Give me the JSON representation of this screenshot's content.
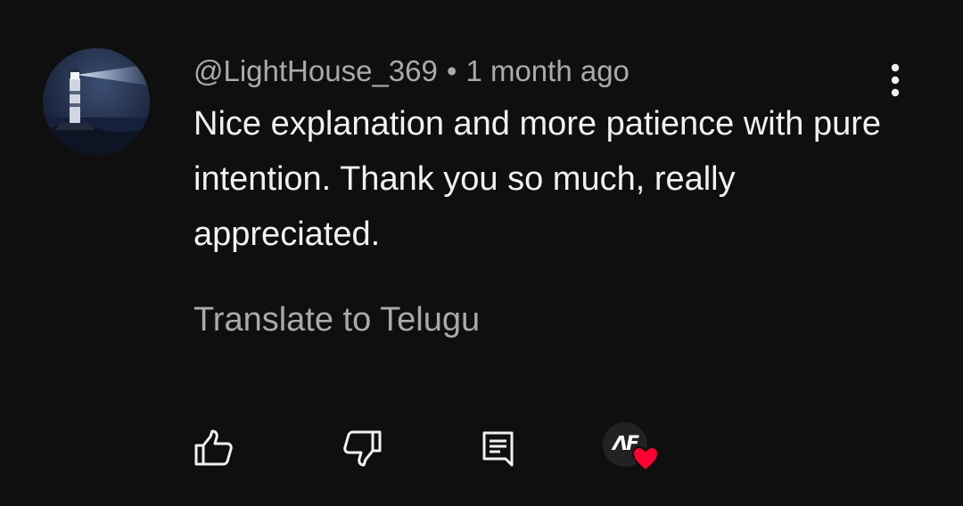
{
  "comment": {
    "author": "@LightHouse_369",
    "separator": "•",
    "timestamp": "1 month ago",
    "text": "Nice explanation and more patience with pure intention. Thank you so much, really appreciated.",
    "translate_label": "Translate to Telugu"
  },
  "actions": {
    "like_icon": "thumbs-up-icon",
    "dislike_icon": "thumbs-down-icon",
    "reply_icon": "reply-comment-icon",
    "more_icon": "vertical-dots-icon"
  },
  "creator_heart": {
    "avatar_label": "ᐱF",
    "heart_icon": "heart-icon",
    "heart_color": "#ff0033"
  },
  "colors": {
    "background": "#0f0f0f",
    "primary_text": "#f1f1f1",
    "secondary_text": "#aaaaaa"
  }
}
